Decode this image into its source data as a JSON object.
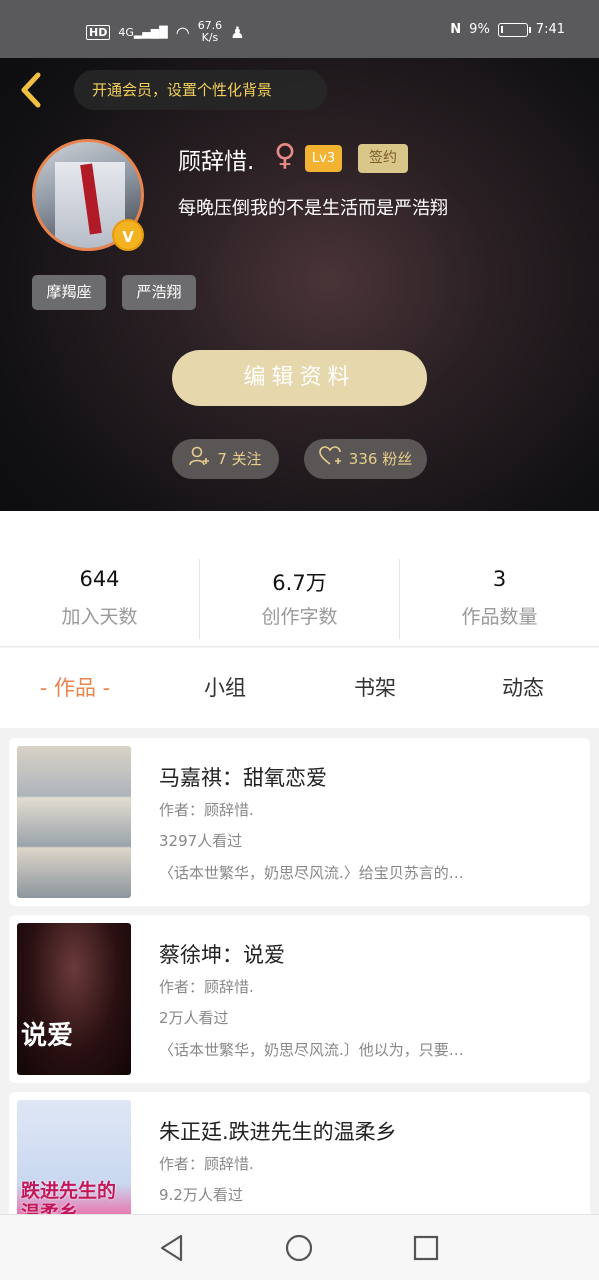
{
  "status_bar": {
    "hd": "HD",
    "signal": "4G",
    "net_speed_value": "67.6",
    "net_speed_unit": "K/s",
    "nfc": "N",
    "battery_percent": "9%",
    "battery_level": 0.09,
    "time": "7:41"
  },
  "header": {
    "vip_prompt": "开通会员，设置个性化背景",
    "username": "顾辞惜.",
    "level": "Lv3",
    "signed_badge": "签约",
    "bio": "每晚压倒我的不是生活而是严浩翔",
    "tags": [
      "摩羯座",
      "严浩翔"
    ],
    "edit_button": "编辑资料",
    "follow_label": "7 关注",
    "fans_label": "336 粉丝",
    "avatar_badge": "V"
  },
  "stats": [
    {
      "value": "644",
      "label": "加入天数"
    },
    {
      "value": "6.7万",
      "label": "创作字数"
    },
    {
      "value": "3",
      "label": "作品数量"
    }
  ],
  "tabs": [
    {
      "label": "- 作品 -"
    },
    {
      "label": "小组"
    },
    {
      "label": "书架"
    },
    {
      "label": "动态"
    }
  ],
  "works": [
    {
      "title": "马嘉祺：甜氧恋爱",
      "author": "作者：顾辞惜.",
      "views": "3297人看过",
      "desc": "〈话本世繁华，奶思尽风流.〉给宝贝苏言的…"
    },
    {
      "title": "蔡徐坤：说爱",
      "author": "作者：顾辞惜.",
      "views": "2万人看过",
      "desc": "〈话本世繁华，奶思尽风流.〕他以为，只要…",
      "cover_text": "说爱"
    },
    {
      "title": "朱正廷.跌进先生的温柔乡",
      "author": "作者：顾辞惜.",
      "views": "9.2万人看过",
      "desc": "",
      "cover_text": "跌进先生的温柔乡"
    }
  ]
}
